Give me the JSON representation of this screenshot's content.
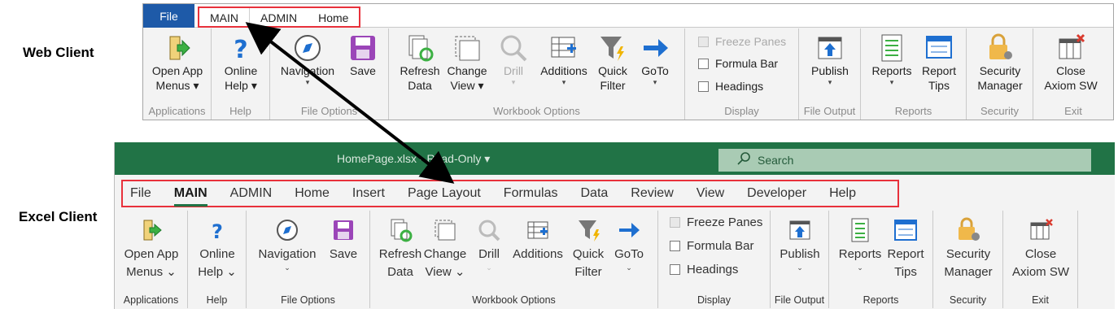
{
  "labels": {
    "web": "Web Client",
    "excel": "Excel Client"
  },
  "web": {
    "file_tab": "File",
    "tabs": [
      "MAIN",
      "ADMIN",
      "Home"
    ],
    "groups": {
      "applications": "Applications",
      "help": "Help",
      "file_options": "File Options",
      "workbook_options": "Workbook Options",
      "display": "Display",
      "file_output": "File Output",
      "reports": "Reports",
      "security": "Security",
      "exit": "Exit"
    },
    "buttons": {
      "open_app_1": "Open App",
      "open_app_2": "Menus ▾",
      "online_help_1": "Online",
      "online_help_2": "Help ▾",
      "navigation": "Navigation",
      "save": "Save",
      "refresh_1": "Refresh",
      "refresh_2": "Data",
      "change_view_1": "Change",
      "change_view_2": "View ▾",
      "drill": "Drill",
      "additions": "Additions",
      "quick_filter_1": "Quick",
      "quick_filter_2": "Filter",
      "goto": "GoTo",
      "publish": "Publish",
      "reports": "Reports",
      "report_tips_1": "Report",
      "report_tips_2": "Tips",
      "security_1": "Security",
      "security_2": "Manager",
      "close_1": "Close",
      "close_2": "Axiom SW"
    },
    "checks": {
      "freeze": "Freeze Panes",
      "formula": "Formula Bar",
      "headings": "Headings"
    }
  },
  "excel": {
    "doc_title": "HomePage.xlsx  -  Read-Only  ▾",
    "search_placeholder": "Search",
    "menus": [
      "File",
      "MAIN",
      "ADMIN",
      "Home",
      "Insert",
      "Page Layout",
      "Formulas",
      "Data",
      "Review",
      "View",
      "Developer",
      "Help"
    ],
    "groups": {
      "applications": "Applications",
      "help": "Help",
      "file_options": "File Options",
      "workbook_options": "Workbook Options",
      "display": "Display",
      "file_output": "File Output",
      "reports": "Reports",
      "security": "Security",
      "exit": "Exit"
    },
    "buttons": {
      "open_app_1": "Open App",
      "open_app_2": "Menus ⌄",
      "online_help_1": "Online",
      "online_help_2": "Help ⌄",
      "navigation": "Navigation",
      "save": "Save",
      "refresh_1": "Refresh",
      "refresh_2": "Data",
      "change_view_1": "Change",
      "change_view_2": "View ⌄",
      "drill": "Drill",
      "additions": "Additions",
      "quick_filter_1": "Quick",
      "quick_filter_2": "Filter",
      "goto": "GoTo",
      "publish": "Publish",
      "reports": "Reports",
      "report_tips_1": "Report",
      "report_tips_2": "Tips",
      "security_1": "Security",
      "security_2": "Manager",
      "close_1": "Close",
      "close_2": "Axiom SW"
    },
    "checks": {
      "freeze": "Freeze Panes",
      "formula": "Formula Bar",
      "headings": "Headings"
    }
  },
  "colors": {
    "excel_green": "#217346",
    "web_blue": "#1e5aa8",
    "highlight_red": "#e8313b"
  }
}
